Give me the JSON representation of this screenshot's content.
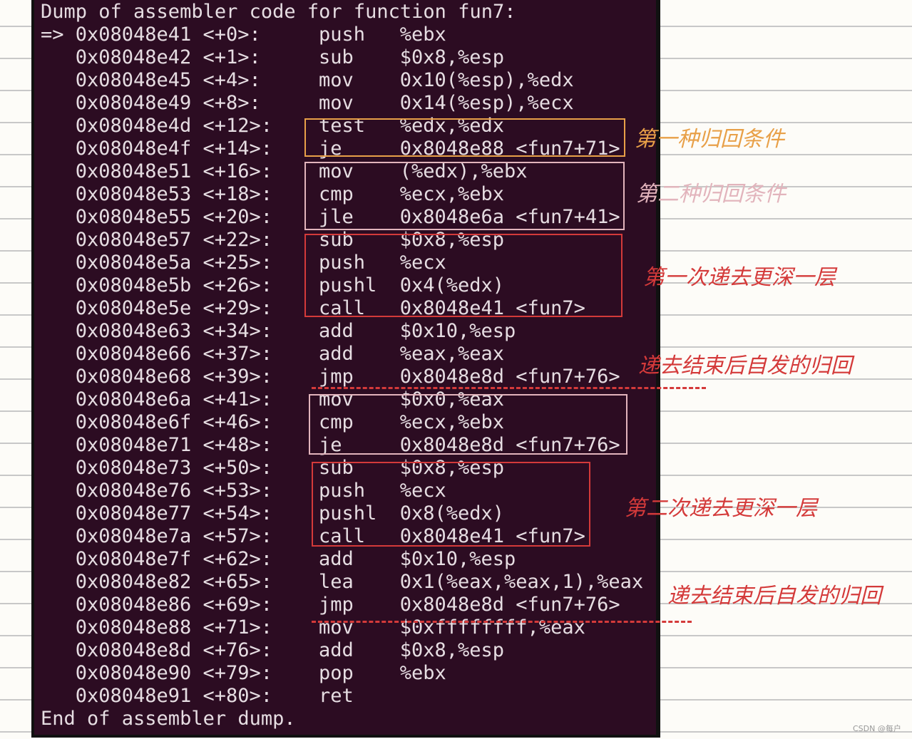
{
  "terminal": {
    "header": "Dump of assembler code for function fun7:",
    "footer": "End of assembler dump.",
    "current_marker": "=>",
    "rows": [
      {
        "addr": "0x08048e41",
        "off": "<+0>:",
        "op": "push",
        "args": "%ebx",
        "current": true
      },
      {
        "addr": "0x08048e42",
        "off": "<+1>:",
        "op": "sub",
        "args": "$0x8,%esp"
      },
      {
        "addr": "0x08048e45",
        "off": "<+4>:",
        "op": "mov",
        "args": "0x10(%esp),%edx"
      },
      {
        "addr": "0x08048e49",
        "off": "<+8>:",
        "op": "mov",
        "args": "0x14(%esp),%ecx"
      },
      {
        "addr": "0x08048e4d",
        "off": "<+12>:",
        "op": "test",
        "args": "%edx,%edx"
      },
      {
        "addr": "0x08048e4f",
        "off": "<+14>:",
        "op": "je",
        "args": "0x8048e88 <fun7+71>"
      },
      {
        "addr": "0x08048e51",
        "off": "<+16>:",
        "op": "mov",
        "args": "(%edx),%ebx"
      },
      {
        "addr": "0x08048e53",
        "off": "<+18>:",
        "op": "cmp",
        "args": "%ecx,%ebx"
      },
      {
        "addr": "0x08048e55",
        "off": "<+20>:",
        "op": "jle",
        "args": "0x8048e6a <fun7+41>"
      },
      {
        "addr": "0x08048e57",
        "off": "<+22>:",
        "op": "sub",
        "args": "$0x8,%esp"
      },
      {
        "addr": "0x08048e5a",
        "off": "<+25>:",
        "op": "push",
        "args": "%ecx"
      },
      {
        "addr": "0x08048e5b",
        "off": "<+26>:",
        "op": "pushl",
        "args": "0x4(%edx)"
      },
      {
        "addr": "0x08048e5e",
        "off": "<+29>:",
        "op": "call",
        "args": "0x8048e41 <fun7>"
      },
      {
        "addr": "0x08048e63",
        "off": "<+34>:",
        "op": "add",
        "args": "$0x10,%esp"
      },
      {
        "addr": "0x08048e66",
        "off": "<+37>:",
        "op": "add",
        "args": "%eax,%eax"
      },
      {
        "addr": "0x08048e68",
        "off": "<+39>:",
        "op": "jmp",
        "args": "0x8048e8d <fun7+76>"
      },
      {
        "addr": "0x08048e6a",
        "off": "<+41>:",
        "op": "mov",
        "args": "$0x0,%eax"
      },
      {
        "addr": "0x08048e6f",
        "off": "<+46>:",
        "op": "cmp",
        "args": "%ecx,%ebx"
      },
      {
        "addr": "0x08048e71",
        "off": "<+48>:",
        "op": "je",
        "args": "0x8048e8d <fun7+76>"
      },
      {
        "addr": "0x08048e73",
        "off": "<+50>:",
        "op": "sub",
        "args": "$0x8,%esp"
      },
      {
        "addr": "0x08048e76",
        "off": "<+53>:",
        "op": "push",
        "args": "%ecx"
      },
      {
        "addr": "0x08048e77",
        "off": "<+54>:",
        "op": "pushl",
        "args": "0x8(%edx)"
      },
      {
        "addr": "0x08048e7a",
        "off": "<+57>:",
        "op": "call",
        "args": "0x8048e41 <fun7>"
      },
      {
        "addr": "0x08048e7f",
        "off": "<+62>:",
        "op": "add",
        "args": "$0x10,%esp"
      },
      {
        "addr": "0x08048e82",
        "off": "<+65>:",
        "op": "lea",
        "args": "0x1(%eax,%eax,1),%eax"
      },
      {
        "addr": "0x08048e86",
        "off": "<+69>:",
        "op": "jmp",
        "args": "0x8048e8d <fun7+76>"
      },
      {
        "addr": "0x08048e88",
        "off": "<+71>:",
        "op": "mov",
        "args": "$0xffffffff,%eax"
      },
      {
        "addr": "0x08048e8d",
        "off": "<+76>:",
        "op": "add",
        "args": "$0x8,%esp"
      },
      {
        "addr": "0x08048e90",
        "off": "<+79>:",
        "op": "pop",
        "args": "%ebx"
      },
      {
        "addr": "0x08048e91",
        "off": "<+80>:",
        "op": "ret",
        "args": ""
      }
    ]
  },
  "annotations": {
    "first_return_condition": "第一种归回条件",
    "second_return_condition": "第二种归回条件",
    "first_recursion": "第一次递去更深一层",
    "return_after_first": "递去结束后自发的归回",
    "second_recursion": "第二次递去更深一层",
    "return_after_second": "递去结束后自发的归回"
  },
  "colors": {
    "orange": "#e8a048",
    "pink": "#e2b4bc",
    "red": "#d43a3a",
    "terminal_bg": "#2c0c22"
  },
  "watermark": "CSDN @每户"
}
